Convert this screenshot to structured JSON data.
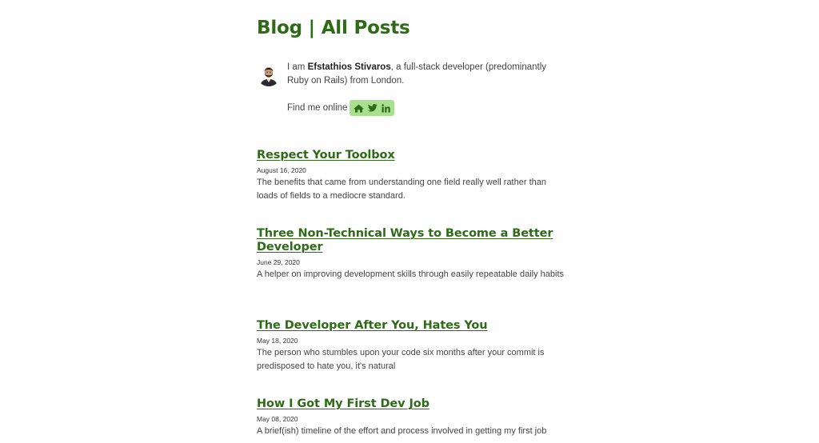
{
  "header": {
    "title": "Blog | All Posts"
  },
  "bio": {
    "intro_prefix": "I am ",
    "author_name": "Efstathios Stivaros",
    "intro_suffix": ", a full-stack developer (predominantly Ruby on Rails) from London.",
    "find_online": "Find me online",
    "social_links": [
      "home-icon",
      "twitter-icon",
      "linkedin-icon"
    ],
    "accent_color": "#a8e08f"
  },
  "posts": [
    {
      "title": "Respect Your Toolbox",
      "date": "August 16, 2020",
      "description": "The benefits that came from understanding one field really well rather than loads of fields to a mediocre standard."
    },
    {
      "title": "Three Non-Technical Ways to Become a Better Developer",
      "date": "June 29, 2020",
      "description": "A helper on improving development skills through easily repeatable daily habits"
    },
    {
      "title": "The Developer After You, Hates You",
      "date": "May 18, 2020",
      "description": "The person who stumbles upon your code six months after your commit is predisposed to hate you, it's natural"
    },
    {
      "title": "How I Got My First Dev Job",
      "date": "May 08, 2020",
      "description": "A brief(ish) timeline of the effort and process involved in getting my first job"
    }
  ],
  "colors": {
    "title_green": "#2e6b17",
    "text": "#444444"
  }
}
